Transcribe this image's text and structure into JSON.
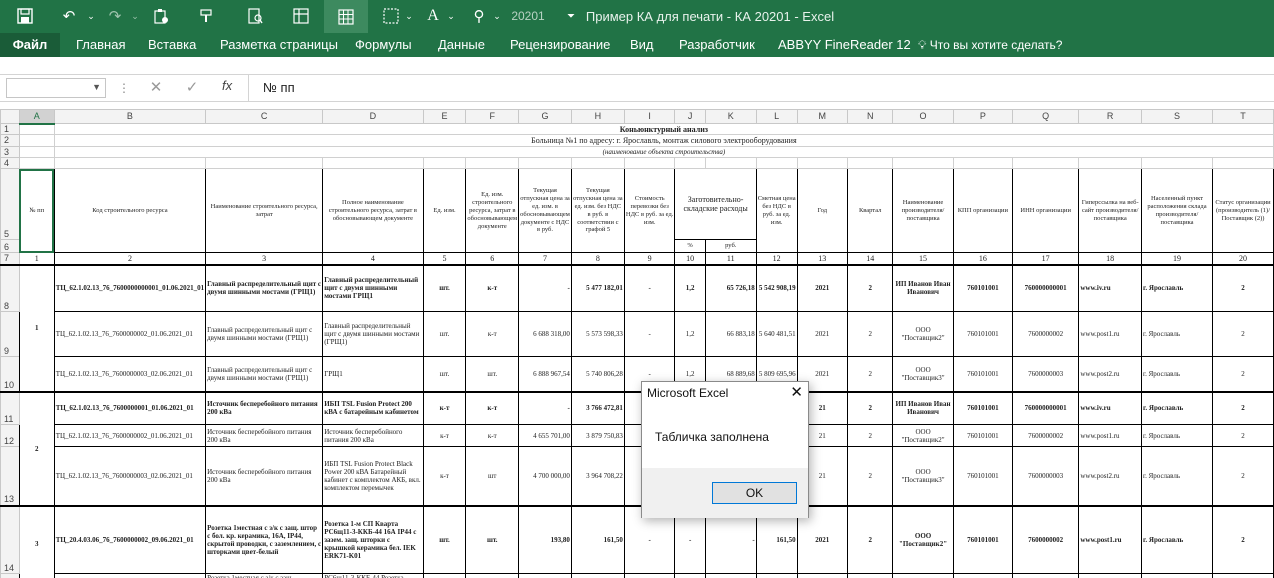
{
  "app": {
    "title": "Пример КА для печати - КА 20201 - Excel",
    "colors": {
      "brand": "#217346",
      "selection": "#217346"
    }
  },
  "quick_access": {
    "icons": [
      "save-icon",
      "undo-icon",
      "redo-icon",
      "paste-special-icon",
      "format-painter-icon",
      "preview-icon",
      "freeze-panes-icon",
      "borders-icon",
      "font-color-icon",
      "zoom-icon",
      "macro-icon",
      "customize-icon"
    ],
    "zoom_value": "20201"
  },
  "ribbon": {
    "tabs": [
      "Файл",
      "Главная",
      "Вставка",
      "Разметка страницы",
      "Формулы",
      "Данные",
      "Рецензирование",
      "Вид",
      "Разработчик",
      "ABBYY FineReader 12"
    ],
    "tell_me": "Что вы хотите сделать?"
  },
  "formula_bar": {
    "name_box": "",
    "fx": "fx",
    "value": "№ пп"
  },
  "sheet": {
    "columns": [
      "A",
      "B",
      "C",
      "D",
      "E",
      "F",
      "G",
      "H",
      "I",
      "J",
      "K",
      "L",
      "M",
      "N",
      "O",
      "P",
      "Q",
      "R",
      "S",
      "T"
    ],
    "rows": [
      "1",
      "2",
      "3",
      "4",
      "5",
      "6",
      "7",
      "8",
      "9",
      "10",
      "11",
      "12",
      "13",
      "14"
    ],
    "title_lines": [
      "Коньюнктурный анализ",
      "Больница №1 по адресу: г. Ярославль, монтаж силового электрооборудования",
      "(наименование объекта строительства)"
    ],
    "header": {
      "a": "№ пп",
      "b": "Код строительного ресурса",
      "c": "Наименование строительного ресурса, затрат",
      "d": "Полное наименование строительного ресурса, затрат в обосновывающем документе",
      "e": "Ед. изм.",
      "f": "Ед. изм. строительного ресурса, затрат в обосновывающем документе",
      "g": "Текущая отпускная цена за ед. изм. в обосновывающем документе с НДС в руб.",
      "h": "Текущая отпускная цена за ед. изм. без НДС в руб. в соответствии с графой 5",
      "i": "Стоимость перевозки без НДС в руб. за ед. изм.",
      "jk": "Заготовительно-складские расходы",
      "j": "%",
      "k": "руб.",
      "l": "Сметная цена без НДС в руб. за ед. изм.",
      "m": "Год",
      "n": "Квартал",
      "o": "Наименование производителя/поставщика",
      "p": "КПП организации",
      "q": "ИНН организации",
      "r": "Гиперссылка на веб-сайт производителя/поставщика",
      "s": "Населенный пункт расположения склада производителя/поставщика",
      "t": "Статус организации (производитель (1)/Поставщик (2))"
    },
    "col_numbers": [
      "1",
      "2",
      "3",
      "4",
      "5",
      "6",
      "7",
      "8",
      "9",
      "10",
      "11",
      "12",
      "13",
      "14",
      "15",
      "16",
      "17",
      "18",
      "19",
      "20"
    ],
    "groups": [
      {
        "num": "1",
        "rows": [
          {
            "code": "ТЦ_62.1.02.13_76_7600000000001_01.06.2021_01",
            "name": "Главный распределительный щит с двумя шинными мостами (ГРЩ1)",
            "full": "Главный распределительный щит с двумя шинными мостами ГРЩ1",
            "unit": "шт.",
            "unit_doc": "к-т",
            "price_vat": "-",
            "price": "5 477 182,01",
            "transport": "-",
            "zsr_pct": "1,2",
            "zsr_rub": "65 726,18",
            "est": "5 542 908,19",
            "year": "2021",
            "quarter": "2",
            "supplier": "ИП Иванов Иван Иванович",
            "kpp": "760101001",
            "inn": "760000000001",
            "site": "www.iv.ru",
            "city": "г. Ярославль",
            "status": "2",
            "bold": true
          },
          {
            "code": "ТЦ_62.1.02.13_76_7600000002_01.06.2021_01",
            "name": "Главный распределительный щит с двумя шинными мостами (ГРЩ1)",
            "full": "Главный распределительный щит с двумя шинными мостами (ГРЩ1)",
            "unit": "шт.",
            "unit_doc": "к-т",
            "price_vat": "6 688 318,00",
            "price": "5 573 598,33",
            "transport": "-",
            "zsr_pct": "1,2",
            "zsr_rub": "66 883,18",
            "est": "5 640 481,51",
            "year": "2021",
            "quarter": "2",
            "supplier": "ООО \"Поставщик2\"",
            "kpp": "760101001",
            "inn": "7600000002",
            "site": "www.post1.ru",
            "city": "г. Ярославль",
            "status": "2",
            "bold": false
          },
          {
            "code": "ТЦ_62.1.02.13_76_7600000003_02.06.2021_01",
            "name": "Главный распределительный щит с двумя шинными мостами (ГРЩ1)",
            "full": "ГРЩ1",
            "unit": "шт.",
            "unit_doc": "шт.",
            "price_vat": "6 888 967,54",
            "price": "5 740 806,28",
            "transport": "-",
            "zsr_pct": "1,2",
            "zsr_rub": "68 889,68",
            "est": "5 809 695,96",
            "year": "2021",
            "quarter": "2",
            "supplier": "ООО \"Поставщик3\"",
            "kpp": "760101001",
            "inn": "7600000003",
            "site": "www.post2.ru",
            "city": "г. Ярославль",
            "status": "2",
            "bold": false
          }
        ]
      },
      {
        "num": "2",
        "rows": [
          {
            "code": "ТЦ_62.1.02.13_76_7600000001_01.06.2021_01",
            "name": "Источник бесперебойного питания 200 кВа",
            "full": "ИБП TSL Fusion Protect 200 кВА с батарейным кабинетом",
            "unit": "к-т",
            "unit_doc": "к-т",
            "price_vat": "-",
            "price": "3 766 472,81",
            "transport": "-",
            "zsr_pct": "",
            "zsr_rub": "",
            "est": "",
            "year": "21",
            "quarter": "2",
            "supplier": "ИП Иванов Иван Иванович",
            "kpp": "760101001",
            "inn": "760000000001",
            "site": "www.iv.ru",
            "city": "г. Ярославль",
            "status": "2",
            "bold": true
          },
          {
            "code": "ТЦ_62.1.02.13_76_7600000002_01.06.2021_01",
            "name": "Источник бесперебойного питания 200 кВа",
            "full": "Источник бесперебойного питания 200 кВа",
            "unit": "к-т",
            "unit_doc": "к-т",
            "price_vat": "4 655 701,00",
            "price": "3 879 750,83",
            "transport": "-",
            "zsr_pct": "",
            "zsr_rub": "",
            "est": "",
            "year": "21",
            "quarter": "2",
            "supplier": "ООО \"Поставщик2\"",
            "kpp": "760101001",
            "inn": "7600000002",
            "site": "www.post1.ru",
            "city": "г. Ярославль",
            "status": "2",
            "bold": false
          },
          {
            "code": "ТЦ_62.1.02.13_76_7600000003_02.06.2021_01",
            "name": "Источник бесперебойного питания 200 кВа",
            "full": "ИБП TSL Fusion Protect Black Power 200 кВА Батарейный кабинет с комплектом АКБ, вкл. комплектом перемычек",
            "unit": "к-т",
            "unit_doc": "шт",
            "price_vat": "4 700 000,00",
            "price": "3 964 708,22",
            "transport": "-",
            "zsr_pct": "",
            "zsr_rub": "",
            "est": "",
            "year": "21",
            "quarter": "2",
            "supplier": "ООО \"Поставщик3\"",
            "kpp": "760101001",
            "inn": "7600000003",
            "site": "www.post2.ru",
            "city": "г. Ярославль",
            "status": "2",
            "bold": false
          }
        ]
      },
      {
        "num": "3",
        "rows": [
          {
            "code": "ТЦ_20.4.03.06_76_7600000002_09.06.2021_01",
            "name": "Розетка 1местная с з/к с защ. штор с бол. кр. керамика, 16А, IP44, скрытой проводки, с заземлением, с шторками цвет-белый",
            "full": "Розетка 1-м СП Кварта РС6щ11-3-ККБ-44 16А IP44 с зазем. защ. шторки с крышкой керамика бел. IEK ERK71-K01",
            "unit": "шт.",
            "unit_doc": "шт.",
            "price_vat": "193,80",
            "price": "161,50",
            "transport": "-",
            "zsr_pct": "-",
            "zsr_rub": "-",
            "est": "161,50",
            "year": "2021",
            "quarter": "2",
            "supplier": "ООО \"Поставщик2\"",
            "kpp": "760101001",
            "inn": "7600000002",
            "site": "www.post1.ru",
            "city": "г. Ярославль",
            "status": "2",
            "bold": true
          },
          {
            "code": "",
            "name": "Розетка 1местная с з/к с защ.",
            "full": "РС6щ11-3-ККБ-44 Розетка",
            "unit": "",
            "unit_doc": "",
            "price_vat": "",
            "price": "",
            "transport": "",
            "zsr_pct": "",
            "zsr_rub": "",
            "est": "",
            "year": "",
            "quarter": "",
            "supplier": "",
            "kpp": "",
            "inn": "",
            "site": "",
            "city": "",
            "status": "",
            "bold": false
          }
        ]
      }
    ]
  },
  "dialog": {
    "title": "Microsoft Excel",
    "message": "Табличка заполнена",
    "ok_label": "OK"
  }
}
